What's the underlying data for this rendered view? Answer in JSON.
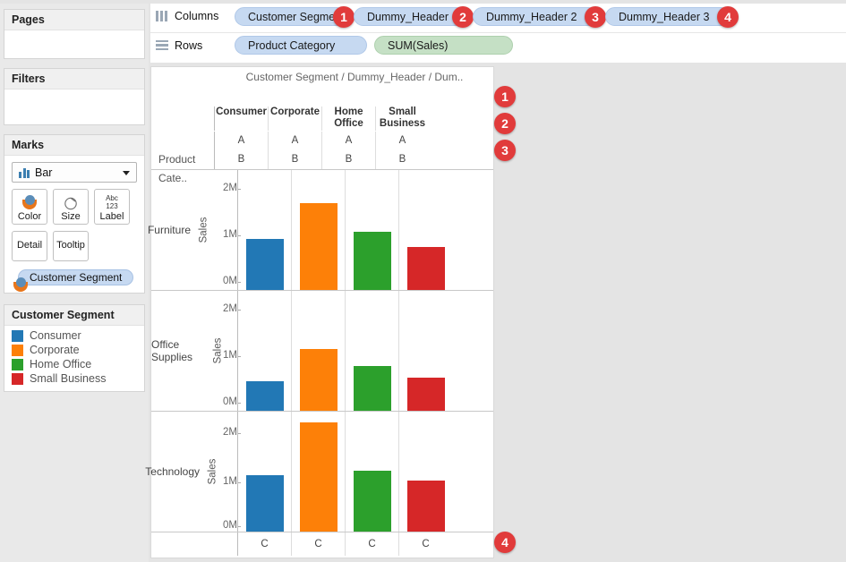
{
  "sidebar": {
    "pages": {
      "title": "Pages"
    },
    "filters": {
      "title": "Filters"
    },
    "marks": {
      "title": "Marks",
      "mark_type": "Bar",
      "mark_type_icon": "bar-chart-icon",
      "buttons": [
        {
          "label": "Color",
          "icon": "color-palette-icon"
        },
        {
          "label": "Size",
          "icon": "size-circle-icon"
        },
        {
          "label": "Label",
          "icon": "abc-123-icon"
        },
        {
          "label": "Detail",
          "icon": "detail-icon"
        },
        {
          "label": "Tooltip",
          "icon": "tooltip-icon"
        }
      ],
      "color_pill": "Customer Segment",
      "color_pill_icon": "color-palette-icon"
    },
    "legend": {
      "title": "Customer Segment",
      "items": [
        {
          "label": "Consumer",
          "color": "#2278b5"
        },
        {
          "label": "Corporate",
          "color": "#fd8008"
        },
        {
          "label": "Home Office",
          "color": "#2ca02c"
        },
        {
          "label": "Small Business",
          "color": "#d62728"
        }
      ]
    }
  },
  "shelves": {
    "columns": {
      "label": "Columns",
      "icon": "columns-icon",
      "pills": [
        {
          "text": "Customer Segment",
          "kind": "dimension",
          "badge": "1"
        },
        {
          "text": "Dummy_Header",
          "kind": "dimension",
          "badge": "2"
        },
        {
          "text": "Dummy_Header 2",
          "kind": "dimension",
          "badge": "3"
        },
        {
          "text": "Dummy_Header 3",
          "kind": "dimension",
          "badge": "4"
        }
      ]
    },
    "rows": {
      "label": "Rows",
      "icon": "rows-icon",
      "pills": [
        {
          "text": "Product Category",
          "kind": "dimension",
          "badge": ""
        },
        {
          "text": "SUM(Sales)",
          "kind": "measure",
          "badge": ""
        }
      ]
    }
  },
  "viz": {
    "header_path": "Customer Segment / Dummy_Header / Dum..",
    "row_field_label": "Product Cate..",
    "axis_title": "Sales",
    "sub_header_rows": [
      "A",
      "B"
    ],
    "footer_row": "C",
    "badges_right": [
      "1",
      "2",
      "3"
    ],
    "badge_bottom": "4"
  },
  "chart_data": {
    "type": "bar",
    "title": "Customer Segment / Dummy_Header / Dum..",
    "xlabel": "Customer Segment",
    "ylabel": "Sales",
    "ylim": [
      0,
      2400000
    ],
    "yticks": [
      "0M",
      "1M",
      "2M"
    ],
    "ytick_values": [
      0,
      1000000,
      2000000
    ],
    "grid": false,
    "legend": "left",
    "categories": [
      "Consumer",
      "Corporate",
      "Home Office",
      "Small Business"
    ],
    "panels": [
      {
        "row": "Furniture",
        "values": [
          1100000,
          1870000,
          1250000,
          930000
        ]
      },
      {
        "row": "Office Supplies",
        "values": [
          630000,
          1330000,
          960000,
          720000
        ]
      },
      {
        "row": "Technology",
        "values": [
          1180000,
          2250000,
          1270000,
          1080000
        ]
      }
    ],
    "series_colors": [
      "#2278b5",
      "#fd8008",
      "#2ca02c",
      "#d62728"
    ]
  }
}
